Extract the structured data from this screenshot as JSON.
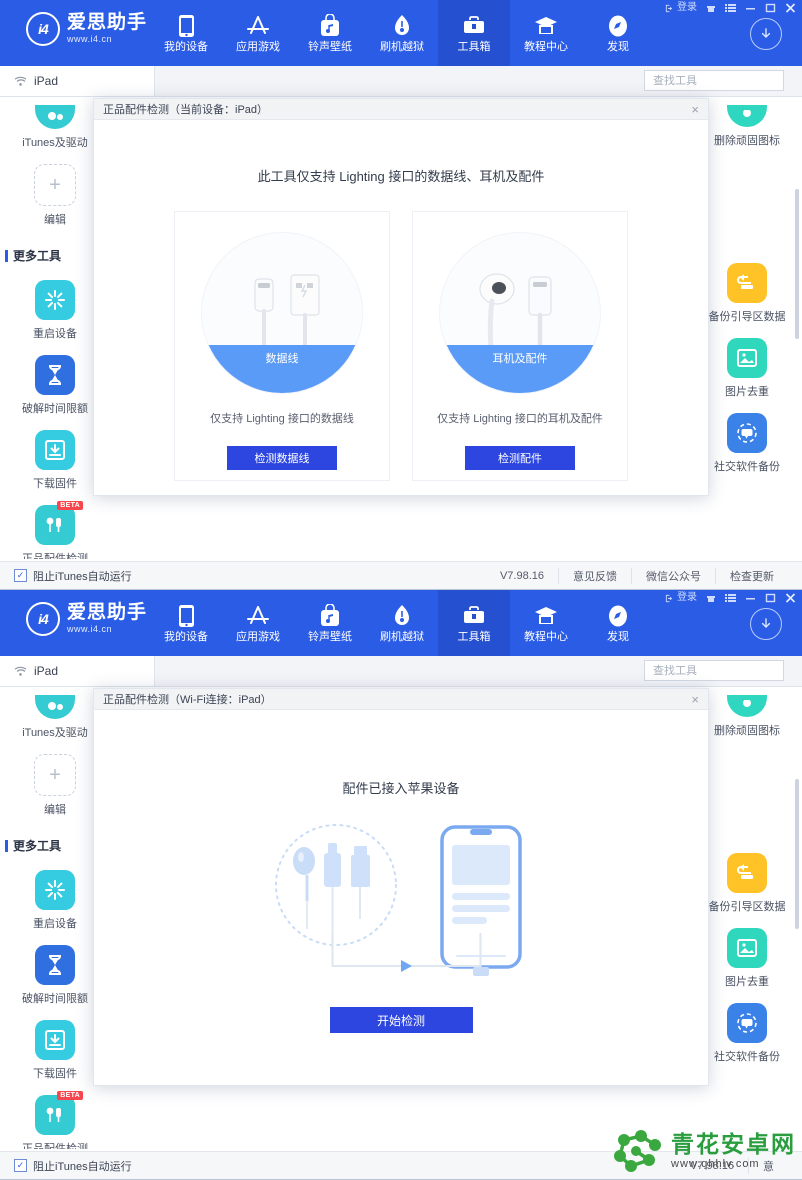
{
  "app": {
    "logo_name": "爱思助手",
    "logo_url": "www.i4.cn",
    "logo_mark": "i4"
  },
  "window_controls": {
    "login": "登录",
    "icons": [
      "login-icon",
      "gift-icon",
      "menu-icon",
      "minimize-icon",
      "maximize-icon",
      "close-icon"
    ]
  },
  "nav": {
    "items": [
      {
        "label": "我的设备",
        "icon": "phone-icon",
        "active": false
      },
      {
        "label": "应用游戏",
        "icon": "appstore-icon",
        "active": false
      },
      {
        "label": "铃声壁纸",
        "icon": "music-bag-icon",
        "active": false
      },
      {
        "label": "刷机越狱",
        "icon": "flash-icon",
        "active": false
      },
      {
        "label": "工具箱",
        "icon": "toolbox-icon",
        "active": true
      },
      {
        "label": "教程中心",
        "icon": "graduation-icon",
        "active": false
      },
      {
        "label": "发现",
        "icon": "compass-icon",
        "active": false
      }
    ],
    "download_icon": "download-circle-icon"
  },
  "device": {
    "name": "iPad",
    "icon": "wifi-icon"
  },
  "search": {
    "placeholder": "查找工具",
    "value": "",
    "icon": "search-icon"
  },
  "sidebar_left": {
    "top_items": [
      {
        "label": "iTunes及驱动",
        "icon": "itunes-driver-icon",
        "color": "#35cbd2"
      },
      {
        "label": "编辑",
        "icon": "plus-icon",
        "color": "#ffffff"
      }
    ],
    "section_title": "更多工具",
    "items": [
      {
        "label": "重启设备",
        "icon": "restart-icon",
        "color": "#35cbe0",
        "badge": ""
      },
      {
        "label": "破解时间限额",
        "icon": "hourglass-icon",
        "color": "#2f6fe0",
        "badge": ""
      },
      {
        "label": "下载固件",
        "icon": "download-box-icon",
        "color": "#35cbe0",
        "badge": ""
      },
      {
        "label": "正品配件检测",
        "icon": "earphone-icon",
        "color": "#35cbd2",
        "badge": "BETA"
      }
    ]
  },
  "sidebar_right": {
    "top_items": [
      {
        "label": "删除顽固图标",
        "icon": "delete-icon",
        "color": "#2fd6c0"
      }
    ],
    "items": [
      {
        "label": "备份引导区数据",
        "icon": "backup-icon",
        "color": "#ffc328"
      },
      {
        "label": "图片去重",
        "icon": "image-icon",
        "color": "#2fd8bd"
      },
      {
        "label": "社交软件备份",
        "icon": "chat-backup-icon",
        "color": "#3b82e8"
      }
    ]
  },
  "dialog_top": {
    "title": "正品配件检测（当前设备：iPad）",
    "close_icon": "close-icon",
    "lead": "此工具仅支持 Lighting 接口的数据线、耳机及配件",
    "cards": [
      {
        "band_label": "数据线",
        "desc": "仅支持 Lighting 接口的数据线",
        "button": "检测数据线",
        "icon": "lightning-cable-icon"
      },
      {
        "band_label": "耳机及配件",
        "desc": "仅支持 Lighting 接口的耳机及配件",
        "button": "检测配件",
        "icon": "earpods-icon"
      }
    ]
  },
  "dialog_bottom": {
    "title": "正品配件检测（Wi-Fi连接：iPad）",
    "close_icon": "close-icon",
    "lead": "配件已接入苹果设备",
    "button": "开始检测",
    "illustration": "accessories-to-phone-icon"
  },
  "statusbar": {
    "checkbox_label": "阻止iTunes自动运行",
    "checked": true,
    "version": "V7.98.16",
    "links": [
      "意见反馈",
      "微信公众号",
      "检查更新"
    ],
    "links_truncated": [
      "意"
    ]
  },
  "watermark": {
    "name": "青花安卓网",
    "url": "www.qhhlv.com",
    "color": "#2a9d3f"
  }
}
